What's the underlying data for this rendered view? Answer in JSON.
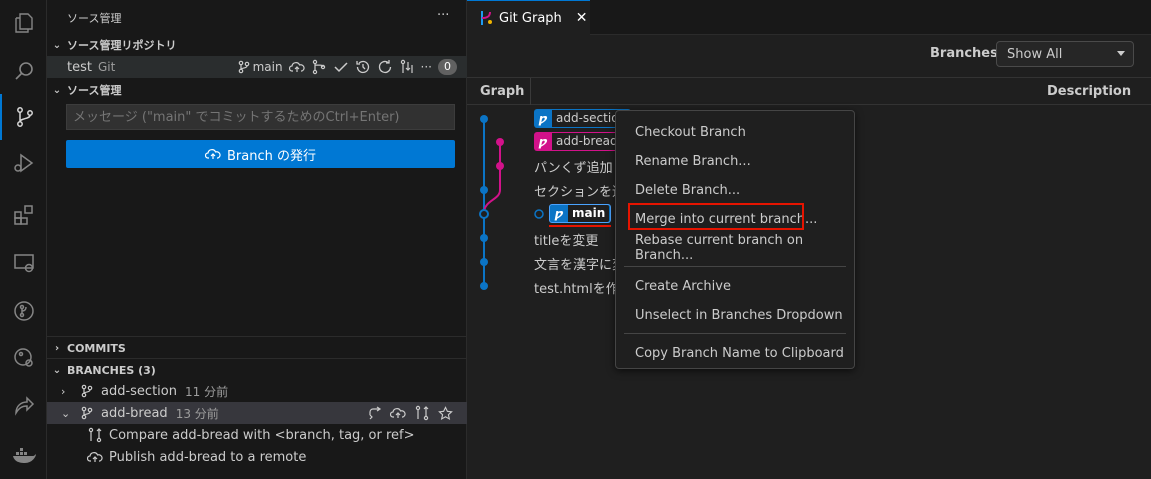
{
  "activity_bar": {
    "icons": [
      "explorer-icon",
      "search-icon",
      "source-control-icon",
      "run-debug-icon",
      "extensions-icon",
      "remote-explorer-icon",
      "git-graph-activity-icon",
      "github-icon",
      "live-share-icon",
      "docker-icon"
    ]
  },
  "sidebar": {
    "title": "ソース管理",
    "more": "···",
    "repos_header": "ソース管理リポジトリ",
    "repo": {
      "name": "test",
      "type": "Git",
      "branch": "main",
      "badge": "0",
      "more": "···"
    },
    "scm_header": "ソース管理",
    "message_placeholder": "メッセージ (\"main\" でコミットするためのCtrl+Enter)",
    "publish_button": "Branch の発行",
    "commits_header": "COMMITS",
    "branches_header": "BRANCHES (3)",
    "branches": [
      {
        "name": "add-section",
        "time": "11 分前"
      },
      {
        "name": "add-bread",
        "time": "13 分前"
      }
    ],
    "sub_items": [
      {
        "label": "Compare add-bread with <branch, tag, or ref>"
      },
      {
        "label": "Publish add-bread to a remote"
      }
    ]
  },
  "editor": {
    "tab_label": "Git Graph",
    "tab_close": "✕",
    "branches_label": "Branches:",
    "branches_value": "Show All",
    "col_graph": "Graph",
    "col_description": "Description",
    "refs": [
      {
        "name": "add-section",
        "color": "#0b74c5"
      },
      {
        "name": "add-bread",
        "color": "#d2128a"
      },
      {
        "name": "main",
        "color": "#0b74c5"
      }
    ],
    "commits": [
      "パンくず追加",
      "セクションを追",
      "titleを変更",
      "文言を漢字に変",
      "test.htmlを作成"
    ],
    "colors": {
      "accent": "#0078d4",
      "blue": "#0b74c5",
      "magenta": "#d2128a",
      "highlight": "#e51400"
    }
  },
  "context_menu": {
    "items": [
      "Checkout Branch",
      "Rename Branch...",
      "Delete Branch...",
      "Merge into current branch...",
      "Rebase current branch on Branch...",
      "Create Archive",
      "Unselect in Branches Dropdown",
      "Copy Branch Name to Clipboard"
    ]
  }
}
